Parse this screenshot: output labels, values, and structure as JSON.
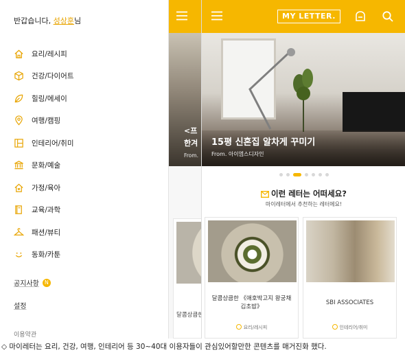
{
  "drawer": {
    "greeting": "반갑습니다,",
    "username": "성상훈",
    "suffix": "님",
    "menu": [
      {
        "label": "요리/레시피",
        "icon": "home-icon"
      },
      {
        "label": "건강/다이어트",
        "icon": "cube-icon"
      },
      {
        "label": "힐링/에세이",
        "icon": "leaf-icon"
      },
      {
        "label": "여행/캠핑",
        "icon": "pin-icon"
      },
      {
        "label": "인테리어/취미",
        "icon": "layout-icon"
      },
      {
        "label": "문화/예술",
        "icon": "museum-icon"
      },
      {
        "label": "가정/육아",
        "icon": "house-heart-icon"
      },
      {
        "label": "교육/과학",
        "icon": "book-icon"
      },
      {
        "label": "패션/뷰티",
        "icon": "hanger-icon"
      },
      {
        "label": "동화/카툰",
        "icon": "smile-icon"
      }
    ],
    "notice": "공지사항",
    "notice_badge": "N",
    "settings": "설정",
    "terms": "이용약관"
  },
  "sliver": {
    "hero_line1": "<프",
    "hero_line2": "한겨",
    "hero_from": "From."
  },
  "app": {
    "logo": "MY LETTER.",
    "hero_title": "15평 신혼집 알차게 꾸미기",
    "hero_from": "From. 아이엠스디자인",
    "slides_count": 7,
    "active_slide": 2,
    "rec_title": "이런 레터는 어떠세요?",
    "rec_subtitle": "마이레터에서 추천하는 레터에요!",
    "cards": [
      {
        "caption": "달콤상큼한 《애호박고지 왕궁채 김초밥》",
        "tag": "요리/레시피",
        "image": "kimbap"
      },
      {
        "caption": "SBI ASSOCIATES",
        "tag": "인테리어/취미",
        "image": "cafe"
      }
    ]
  },
  "sliver_card_caption": "달콤상큼한",
  "caption": "◇ 마이레터는 요리, 건강, 여행, 인테리어 등 30~40대 이용자들이 관심있어할만한 콘텐츠를 매거진화 했다.",
  "colors": {
    "accent": "#f6b700",
    "text": "#222222"
  }
}
